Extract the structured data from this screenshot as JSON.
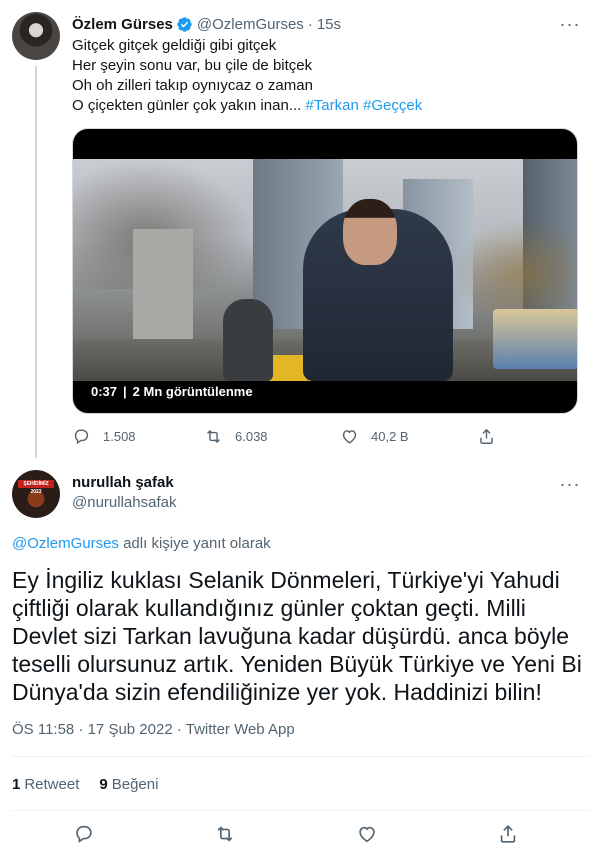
{
  "parent_tweet": {
    "author_name": "Özlem Gürses",
    "handle": "@OzlemGurses",
    "separator": "·",
    "time": "15s",
    "text_lines": [
      "Gitçek gitçek geldiği gibi gitçek",
      "Her şeyin sonu var, bu çile de bitçek",
      "Oh oh zilleri takıp oynıycaz o zaman"
    ],
    "last_line_text": "O çiçekten günler çok yakın inan...",
    "hashtags": [
      "#Tarkan",
      "#Geççek"
    ],
    "video": {
      "duration": "0:37",
      "separator": "|",
      "views": "2 Mn görüntülenme"
    },
    "actions": {
      "reply_count": "1.508",
      "retweet_count": "6.038",
      "like_count": "40,2 B"
    }
  },
  "main_tweet": {
    "author_name": "nurullah şafak",
    "handle": "@nurullahsafak",
    "avatar_badge": "ŞEHİDİMİZ 2023",
    "reply_to_mention": "@OzlemGurses",
    "reply_to_suffix": "adlı kişiye yanıt olarak",
    "text_lines": [
      "Ey İngiliz kuklası Selanik Dönmeleri, Türkiye'yi Yahudi",
      "çiftliği olarak kullandığınız günler çoktan geçti. Milli",
      "Devlet sizi Tarkan lavuğuna kadar düşürdü. anca böyle",
      "teselli olursunuz artık. Yeniden Büyük Türkiye ve Yeni Bi",
      "Dünya'da sizin efendiliğinize yer yok. Haddinizi bilin!"
    ],
    "meta": "ÖS 11:58 · 17 Şub 2022 · Twitter Web App",
    "stats": {
      "retweet_count": "1",
      "retweet_label": "Retweet",
      "like_count": "9",
      "like_label": "Beğeni"
    }
  },
  "icons": {
    "verified": "verified-badge-icon",
    "more": "more-icon",
    "reply": "reply-icon",
    "retweet": "retweet-icon",
    "like": "heart-icon",
    "share": "share-icon"
  },
  "colors": {
    "accent": "#1d9bf0",
    "text_primary": "#0f1419",
    "text_secondary": "#536471",
    "divider": "#eff3f4",
    "thread_line": "#cfd9de"
  }
}
